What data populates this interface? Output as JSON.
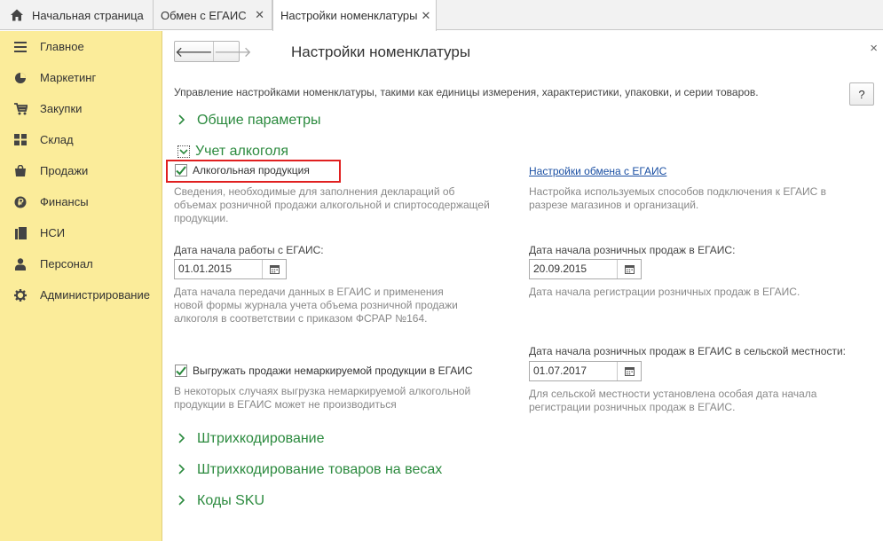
{
  "tabs": {
    "home": "Начальная страница",
    "egais_exchange": "Обмен с ЕГАИС",
    "nomenclature_settings": "Настройки номенклатуры",
    "close_glyph": "✕"
  },
  "sidebar": {
    "items": [
      {
        "label": "Главное",
        "icon": "menu-lines-icon"
      },
      {
        "label": "Маркетинг",
        "icon": "pie-chart-icon"
      },
      {
        "label": "Закупки",
        "icon": "cart-icon"
      },
      {
        "label": "Склад",
        "icon": "warehouse-grid-icon"
      },
      {
        "label": "Продажи",
        "icon": "shopping-bag-icon"
      },
      {
        "label": "Финансы",
        "icon": "ruble-coin-icon"
      },
      {
        "label": "НСИ",
        "icon": "reference-book-icon"
      },
      {
        "label": "Персонал",
        "icon": "person-icon"
      },
      {
        "label": "Администрирование",
        "icon": "gear-icon"
      }
    ],
    "bg_color": "#fbec9a"
  },
  "header": {
    "title": "Настройки номенклатуры",
    "back": "🡐",
    "forward": "🡒",
    "close": "×"
  },
  "description": "Управление настройками номенклатуры, такими как единицы измерения, характеристики, упаковки, и серии товаров.",
  "help_label": "?",
  "groups": {
    "general": "Общие параметры",
    "alcohol": "Учет алкоголя",
    "barcoding": "Штрихкодирование",
    "weighted_barcoding": "Штрихкодирование товаров на весах",
    "sku": "Коды SKU",
    "accent_color": "#2b8a3e"
  },
  "alcohol": {
    "alcohol_products": {
      "label": "Алкогольная продукция",
      "checked": true
    },
    "alcohol_products_note": [
      "Сведения, необходимые для заполнения деклараций об",
      "объемах розничной продажи алкогольной и спиртосодержащей",
      "продукции."
    ],
    "exchange_link": "Настройки обмена с ЕГАИС",
    "exchange_note": [
      "Настройка используемых способов подключения к ЕГАИС в",
      "разрезе магазинов и организаций."
    ],
    "start_date": {
      "label": "Дата начала работы с ЕГАИС:",
      "value": "01.01.2015"
    },
    "start_note": [
      "Дата начала передачи данных в ЕГАИС и применения",
      "новой формы журнала учета объема розничной продажи",
      "алкоголя в соответствии с приказом ФСРАР №164."
    ],
    "retail_date": {
      "label": "Дата начала розничных продаж в ЕГАИС:",
      "value": "20.09.2015"
    },
    "retail_note": "Дата начала регистрации розничных продаж в ЕГАИС.",
    "rural_date": {
      "label": "Дата начала розничных продаж в ЕГАИС в сельской местности:",
      "value": "01.07.2017"
    },
    "rural_note": [
      "Для сельской местности установлена особая дата начала",
      "регистрации розничных продаж в ЕГАИС."
    ],
    "unmarked": {
      "label": "Выгружать продажи немаркируемой продукции в ЕГАИС",
      "checked": true
    },
    "unmarked_note": [
      "В некоторых случаях выгрузка немаркируемой алкогольной",
      "продукции в ЕГАИС может не производиться"
    ]
  }
}
